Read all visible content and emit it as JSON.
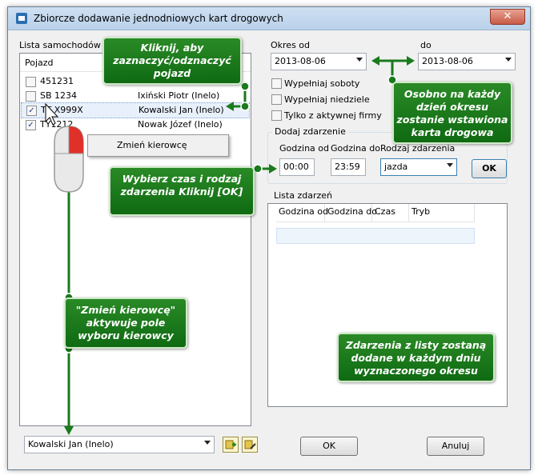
{
  "window": {
    "title": "Zbiorcze dodawanie jednodniowych kart drogowych",
    "close_glyph": "✕"
  },
  "vehicles": {
    "label": "Lista samochodów",
    "columns": [
      "Pojazd",
      ""
    ],
    "rows": [
      {
        "plate": "451231",
        "driver": "",
        "checked": false
      },
      {
        "plate": "SB 1234",
        "driver": "Ixiński Piotr (Inelo)",
        "checked": false
      },
      {
        "plate": "TT X999X",
        "driver": "Kowalski Jan (Inelo)",
        "checked": true
      },
      {
        "plate": "TY1212",
        "driver": "Nowak Józef (Inelo)",
        "checked": true
      }
    ],
    "context_menu_item": "Zmień kierowcę",
    "driver_select_value": "Kowalski Jan (Inelo)"
  },
  "period": {
    "from_label": "Okres od",
    "from_value": "2013-08-06",
    "to_label": "do",
    "to_value": "2013-08-06",
    "options": [
      {
        "label": "Wypełniaj soboty",
        "checked": false
      },
      {
        "label": "Wypełniaj niedziele",
        "checked": false
      },
      {
        "label": "Tylko z aktywnej firmy",
        "checked": false
      }
    ]
  },
  "add_event": {
    "group_label": "Dodaj zdarzenie",
    "start_label": "Godzina od",
    "start_value": "00:00",
    "end_label": "Godzina do",
    "end_value": "23:59",
    "type_label": "Rodzaj zdarzenia",
    "type_value": "jazda",
    "ok_label": "OK"
  },
  "events": {
    "group_label": "Lista zdarzeń",
    "columns": [
      "Godzina od",
      "Godzina do",
      "Czas",
      "Tryb"
    ]
  },
  "footer": {
    "ok_label": "OK",
    "cancel_label": "Anuluj"
  },
  "callouts": {
    "toggle_vehicle": "Kliknij, aby zaznaczyć/odznaczyć pojazd",
    "per_day": "Osobno na każdy dzień okresu zostanie wstawiona karta drogowa",
    "choose_time": "Wybierz czas i rodzaj zdarzenia Kliknij [OK]",
    "change_driver": "\"Zmień kierowcę\" aktywuje pole wyboru kierowcy",
    "events_added": "Zdarzenia z listy zostaną dodane w każdym dniu wyznaczonego okresu"
  },
  "colors": {
    "callout_green": "#1a7a1c",
    "accent_red": "#e0302a"
  },
  "icons": [
    "app-icon",
    "close-icon",
    "mouse-icon",
    "cursor-arrow-icon",
    "add-driver-icon",
    "edit-driver-icon",
    "chevron-down-icon"
  ]
}
